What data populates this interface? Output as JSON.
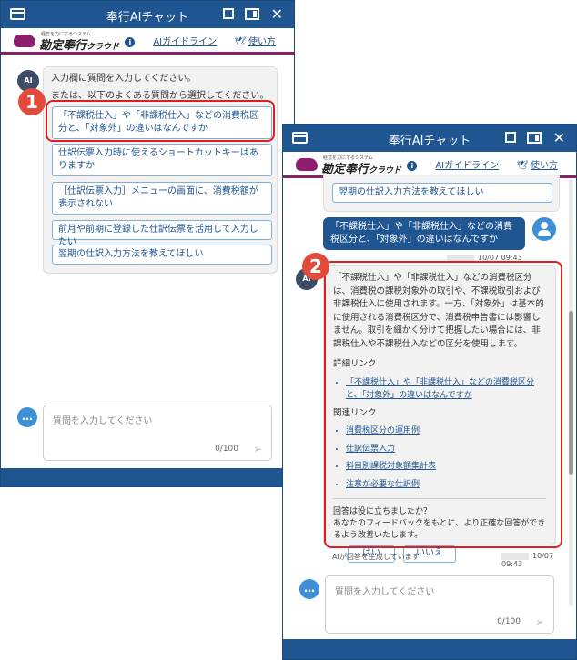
{
  "window": {
    "title": "奉行AIチャット",
    "logo_small": "経営を力にするシステム",
    "logo_name": "勘定奉行",
    "logo_suffix": "クラウド",
    "link_guideline": "AIガイドライン",
    "link_howto": "使い方"
  },
  "screen1": {
    "greeting_line1": "入力欄に質問を入力してください。",
    "greeting_line2": "または、以下のよくある質問から選択してください。",
    "suggestions": [
      "「不課税仕入」や「非課税仕入」などの消費税区分と、「対象外」の違いはなんですか",
      "仕訳伝票入力時に使えるショートカットキーはありますか",
      "［仕訳伝票入力］メニューの画面に、消費税額が表示されない",
      "前月や前期に登録した仕訳伝票を活用して入力したい",
      "翌期の仕訳入力方法を教えてほしい"
    ],
    "input_placeholder": "質問を入力してください",
    "char_count": "0/100",
    "callout_number": "1"
  },
  "screen2": {
    "suggestion_partial": "翌期の仕訳入力方法を教えてほしい",
    "user_question": "「不課税仕入」や「非課税仕入」などの消費税区分と、「対象外」の違いはなんですか",
    "user_time": "10/07 09:43",
    "answer_text": "「不課税仕入」や「非課税仕入」などの消費税区分は、消費税の課税対象外の取引や、不課税取引および非課税仕入に使用されます。一方、「対象外」は基本的に使用される消費税区分で、消費税申告書には影響しません。取引を細かく分けて把握したい場合には、非課税仕入や不課税仕入などの区分を使用します。",
    "detail_heading": "詳細リンク",
    "detail_links": [
      "「不課税仕入」や「非課税仕入」などの消費税区分と、「対象外」の違いはなんですか"
    ],
    "related_heading": "関連リンク",
    "related_links": [
      "消費税区分の運用例",
      "仕訳伝票入力",
      "科目別課税対象額集計表",
      "注意が必要な仕訳例"
    ],
    "feedback_question": "回答は役に立ちましたか？",
    "feedback_note": "あなたのフィードバックをもとに、より正確な回答ができるよう改善いたします。",
    "yes_label": "はい",
    "no_label": "いいえ",
    "ai_note": "AIが回答を生成しています",
    "ai_time": "10/07 09:43",
    "input_placeholder": "質問を入力してください",
    "char_count": "0/100",
    "callout_number": "2"
  },
  "icons": {
    "ai_avatar_text": "AI",
    "chat_icon_text": "…",
    "send_glyph": "➢",
    "close_glyph": "✕",
    "info_glyph": "i",
    "bird_glyph": "🕊"
  },
  "colors": {
    "titlebar": "#1f5590",
    "accent_line": "#8c1e6e",
    "callout": "#e24a3b",
    "highlight_border": "#e01e1e"
  }
}
